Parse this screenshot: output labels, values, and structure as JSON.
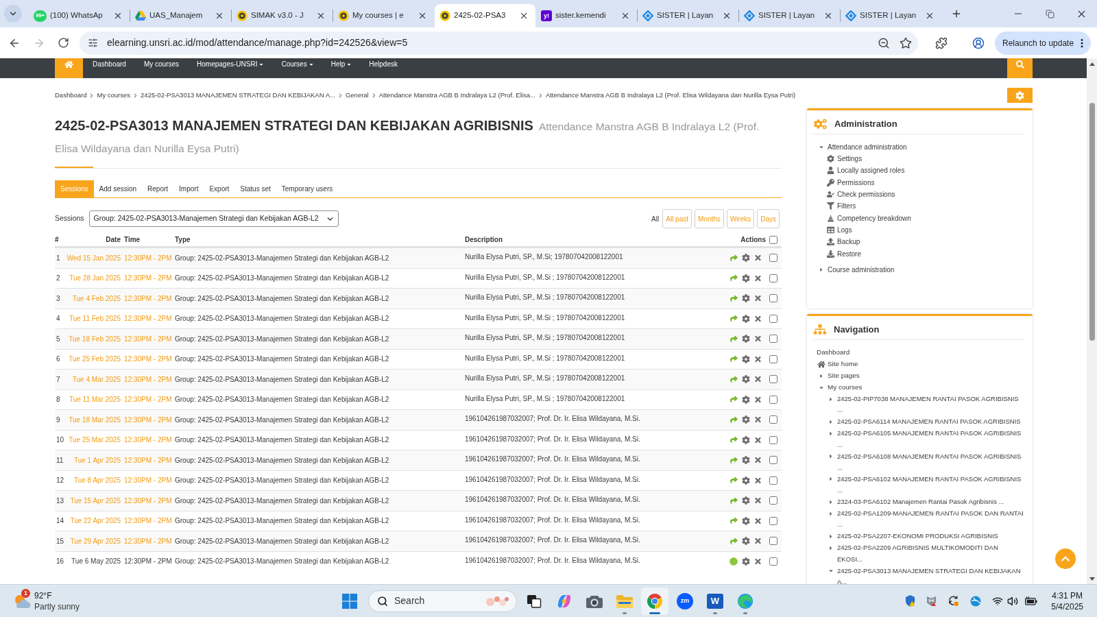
{
  "browser": {
    "tabs": [
      {
        "title": "(100) WhatsAp",
        "kind": "chat",
        "favicon_text": "99+",
        "selected": false
      },
      {
        "title": "UAS_Manajem",
        "kind": "drive",
        "selected": false
      },
      {
        "title": "SIMAK v3.0 - J",
        "kind": "crest",
        "selected": false
      },
      {
        "title": "My courses | e",
        "kind": "crest",
        "selected": false
      },
      {
        "title": "2425-02-PSA3",
        "kind": "crest",
        "selected": true
      },
      {
        "title": "sister.kemendi",
        "kind": "letter",
        "favicon_text": "y!",
        "selected": false
      },
      {
        "title": "SISTER | Layan",
        "kind": "swirl",
        "selected": false
      },
      {
        "title": "SISTER | Layan",
        "kind": "swirl",
        "selected": false
      },
      {
        "title": "SISTER | Layan",
        "kind": "swirl",
        "selected": false
      }
    ],
    "url": "elearning.unsri.ac.id/mod/attendance/manage.php?id=242526&view=5",
    "update_button": "Relaunch to update"
  },
  "navbar": {
    "items": [
      {
        "label": "Dashboard",
        "dropdown": false
      },
      {
        "label": "My courses",
        "dropdown": false
      },
      {
        "label": "Homepages-UNSRI",
        "dropdown": true
      },
      {
        "label": "Courses",
        "dropdown": true
      },
      {
        "label": "Help",
        "dropdown": true
      },
      {
        "label": "Helpdesk",
        "dropdown": false
      }
    ]
  },
  "breadcrumb": [
    "Dashboard",
    "My courses",
    "2425-02-PSA3013 MANAJEMEN STRATEGI DAN KEBIJAKAN A...",
    "General",
    "Attendance Manstra AGB B Indralaya L2 (Prof. Elisa...",
    "Attendance Manstra AGB B Indralaya L2 (Prof. Elisa Wildayana dan Nurilla Eysa Putri)"
  ],
  "heading": {
    "title": "2425-02-PSA3013 MANAJEMEN STRATEGI DAN KEBIJAKAN AGRIBISNIS",
    "subtitle": "Attendance Manstra AGB B Indralaya L2 (Prof. Elisa Wildayana dan Nurilla Eysa Putri)"
  },
  "tabs": [
    {
      "label": "Sessions",
      "selected": true
    },
    {
      "label": "Add session",
      "selected": false
    },
    {
      "label": "Report",
      "selected": false
    },
    {
      "label": "Import",
      "selected": false
    },
    {
      "label": "Export",
      "selected": false
    },
    {
      "label": "Status set",
      "selected": false
    },
    {
      "label": "Temporary users",
      "selected": false
    }
  ],
  "session_filter": {
    "label": "Sessions",
    "group": "Group: 2425-02-PSA3013-Manajemen Strategi dan Kebijakan AGB-L2",
    "views": [
      {
        "label": "All",
        "selected": true
      },
      {
        "label": "All past",
        "selected": false
      },
      {
        "label": "Months",
        "selected": false
      },
      {
        "label": "Weeks",
        "selected": false
      },
      {
        "label": "Days",
        "selected": false
      }
    ]
  },
  "table": {
    "columns": [
      "#",
      "Date",
      "Time",
      "Type",
      "Description",
      "Actions"
    ],
    "select_all": false,
    "rows": [
      {
        "number": "1",
        "date": "Wed 15 Jan 2025",
        "time": "12:30PM - 2PM",
        "type": "Group: 2425-02-PSA3013-Manajemen Strategi dan Kebijakan AGB-L2",
        "description": "Nurilla Elysa Putri, SP., M.Si; 197807042008122001",
        "kind": "past",
        "checked": false
      },
      {
        "number": "2",
        "date": "Tue 28 Jan 2025",
        "time": "12:30PM - 2PM",
        "type": "Group: 2425-02-PSA3013-Manajemen Strategi dan Kebijakan AGB-L2",
        "description": "Nurilla Elysa Putri, SP., M.Si ; 197807042008122001",
        "kind": "past",
        "checked": false
      },
      {
        "number": "3",
        "date": "Tue 4 Feb 2025",
        "time": "12:30PM - 2PM",
        "type": "Group: 2425-02-PSA3013-Manajemen Strategi dan Kebijakan AGB-L2",
        "description": "Nurilla Elysa Putri, SP., M.Si ; 197807042008122001",
        "kind": "past",
        "checked": false
      },
      {
        "number": "4",
        "date": "Tue 11 Feb 2025",
        "time": "12:30PM - 2PM",
        "type": "Group: 2425-02-PSA3013-Manajemen Strategi dan Kebijakan AGB-L2",
        "description": "Nurilla Elysa Putri, SP., M.Si ; 197807042008122001",
        "kind": "past",
        "checked": false
      },
      {
        "number": "5",
        "date": "Tue 18 Feb 2025",
        "time": "12:30PM - 2PM",
        "type": "Group: 2425-02-PSA3013-Manajemen Strategi dan Kebijakan AGB-L2",
        "description": "Nurilla Elysa Putri, SP., M.Si ; 197807042008122001",
        "kind": "past",
        "checked": false
      },
      {
        "number": "6",
        "date": "Tue 25 Feb 2025",
        "time": "12:30PM - 2PM",
        "type": "Group: 2425-02-PSA3013-Manajemen Strategi dan Kebijakan AGB-L2",
        "description": "Nurilla Elysa Putri, SP., M.Si ; 197807042008122001",
        "kind": "past",
        "checked": false
      },
      {
        "number": "7",
        "date": "Tue 4 Mar 2025",
        "time": "12:30PM - 2PM",
        "type": "Group: 2425-02-PSA3013-Manajemen Strategi dan Kebijakan AGB-L2",
        "description": "Nurilla Elysa Putri, SP., M.Si ; 197807042008122001",
        "kind": "past",
        "checked": false
      },
      {
        "number": "8",
        "date": "Tue 11 Mar 2025",
        "time": "12:30PM - 2PM",
        "type": "Group: 2425-02-PSA3013-Manajemen Strategi dan Kebijakan AGB-L2",
        "description": "Nurilla Elysa Putri, SP., M.Si ; 197807042008122001",
        "kind": "past",
        "checked": false
      },
      {
        "number": "9",
        "date": "Tue 18 Mar 2025",
        "time": "12:30PM - 2PM",
        "type": "Group: 2425-02-PSA3013-Manajemen Strategi dan Kebijakan AGB-L2",
        "description": "196104261987032007; Prof. Dr. Ir. Elisa Wildayana, M.Si.",
        "kind": "past",
        "checked": false
      },
      {
        "number": "10",
        "date": "Tue 25 Mar 2025",
        "time": "12:30PM - 2PM",
        "type": "Group: 2425-02-PSA3013-Manajemen Strategi dan Kebijakan AGB-L2",
        "description": "196104261987032007; Prof. Dr. Ir. Elisa Wildayana, M.Si.",
        "kind": "past",
        "checked": false
      },
      {
        "number": "11",
        "date": "Tue 1 Apr 2025",
        "time": "12:30PM - 2PM",
        "type": "Group: 2425-02-PSA3013-Manajemen Strategi dan Kebijakan AGB-L2",
        "description": "196104261987032007; Prof. Dr. Ir. Elisa Wildayana, M.Si.",
        "kind": "past",
        "checked": false
      },
      {
        "number": "12",
        "date": "Tue 8 Apr 2025",
        "time": "12:30PM - 2PM",
        "type": "Group: 2425-02-PSA3013-Manajemen Strategi dan Kebijakan AGB-L2",
        "description": "196104261987032007; Prof. Dr. Ir. Elisa Wildayana, M.Si.",
        "kind": "past",
        "checked": false
      },
      {
        "number": "13",
        "date": "Tue 15 Apr 2025",
        "time": "12:30PM - 2PM",
        "type": "Group: 2425-02-PSA3013-Manajemen Strategi dan Kebijakan AGB-L2",
        "description": "196104261987032007; Prof. Dr. Ir. Elisa Wildayana, M.Si.",
        "kind": "past",
        "checked": false
      },
      {
        "number": "14",
        "date": "Tue 22 Apr 2025",
        "time": "12:30PM - 2PM",
        "type": "Group: 2425-02-PSA3013-Manajemen Strategi dan Kebijakan AGB-L2",
        "description": "196104261987032007; Prof. Dr. Ir. Elisa Wildayana, M.Si.",
        "kind": "past",
        "checked": false
      },
      {
        "number": "15",
        "date": "Tue 29 Apr 2025",
        "time": "12:30PM - 2PM",
        "type": "Group: 2425-02-PSA3013-Manajemen Strategi dan Kebijakan AGB-L2",
        "description": "196104261987032007; Prof. Dr. Ir. Elisa Wildayana, M.Si.",
        "kind": "past",
        "checked": false
      },
      {
        "number": "16",
        "date": "Tue 6 May 2025",
        "time": "12:30PM - 2PM",
        "type": "Group: 2425-02-PSA3013-Manajemen Strategi dan Kebijakan AGB-L2",
        "description": "196104261987032007; Prof. Dr. Ir. Elisa Wildayana, M.Si.",
        "kind": "upcoming",
        "checked": false
      }
    ]
  },
  "sidebar": {
    "administration": {
      "title": "Administration",
      "items": [
        {
          "label": "Attendance administration",
          "expanded": true,
          "children": [
            {
              "label": "Settings",
              "kind": "settings"
            },
            {
              "label": "Locally assigned roles",
              "kind": "roles"
            },
            {
              "label": "Permissions",
              "kind": "permissions"
            },
            {
              "label": "Check permissions",
              "kind": "check"
            },
            {
              "label": "Filters",
              "kind": "filters"
            },
            {
              "label": "Competency breakdown",
              "kind": "competency"
            },
            {
              "label": "Logs",
              "kind": "logs"
            },
            {
              "label": "Backup",
              "kind": "backup"
            },
            {
              "label": "Restore",
              "kind": "restore"
            }
          ]
        },
        {
          "label": "Course administration",
          "expanded": false
        }
      ]
    },
    "navigation": {
      "title": "Navigation",
      "items": [
        {
          "label": "Dashboard",
          "kind": "link"
        },
        {
          "label": "Site home",
          "kind": "home"
        },
        {
          "label": "Site pages",
          "kind": "branch",
          "expanded": false
        },
        {
          "label": "My courses",
          "kind": "branch",
          "expanded": true,
          "children": [
            {
              "label": "2425-02-PIP7038 MANAJEMEN RANTAI PASOK AGRIBISNIS ...",
              "kind": "branch",
              "expanded": false
            },
            {
              "label": "2425-02-PSA6114 MANAJEMEN RANTAI PASOK AGRIBISNIS",
              "kind": "branch",
              "expanded": false
            },
            {
              "label": "2425-02-PSA6105 MANAJEMEN RANTAI PASOK AGRIBISNIS ...",
              "kind": "branch",
              "expanded": false
            },
            {
              "label": "2425-02-PSA6108 MANAJEMEN RANTAI PASOK AGRIBISNIS ...",
              "kind": "branch",
              "expanded": false
            },
            {
              "label": "2425-02-PSA6102 MANAJEMEN RANTAI PASOK AGRIBISNIS ...",
              "kind": "branch",
              "expanded": false
            },
            {
              "label": "2324-03-PSA6102 Manajemen Rantai Pasok Agribisnis ...",
              "kind": "branch",
              "expanded": false
            },
            {
              "label": "2425-02-PSA1209-MANAJEMEN RANTAI PASOK DAN RANTAI ...",
              "kind": "branch",
              "expanded": false
            },
            {
              "label": "2425-02-PSA2207-EKONOMI PRODUKSI AGRIBISNIS",
              "kind": "branch",
              "expanded": false
            },
            {
              "label": "2425-02-PSA2209 AGRIBISNIS MULTIKOMODITI DAN EKOSI...",
              "kind": "branch",
              "expanded": false
            },
            {
              "label": "2425-02-PSA3013 MANAJEMEN STRATEGI DAN KEBIJAKAN A...",
              "kind": "branch",
              "expanded": true
            }
          ]
        }
      ]
    }
  },
  "taskbar": {
    "weather": {
      "badge": "1",
      "temperature": "92°F",
      "condition": "Partly sunny"
    },
    "search": {
      "placeholder": "Search"
    },
    "apps": [
      {
        "kind": "task_view",
        "running": false,
        "selected": false
      },
      {
        "kind": "assistant",
        "running": false,
        "selected": false
      },
      {
        "kind": "camera",
        "running": false,
        "selected": false
      },
      {
        "kind": "files",
        "running": true,
        "selected": false
      },
      {
        "kind": "chrome",
        "running": true,
        "selected": true
      },
      {
        "kind": "meeting",
        "glyph": "zm",
        "running": false,
        "selected": false
      },
      {
        "kind": "word",
        "glyph": "W",
        "running": true,
        "selected": false
      },
      {
        "kind": "edge",
        "running": true,
        "selected": false
      }
    ],
    "clock": {
      "time": "4:31 PM",
      "date": "5/4/2025"
    }
  }
}
